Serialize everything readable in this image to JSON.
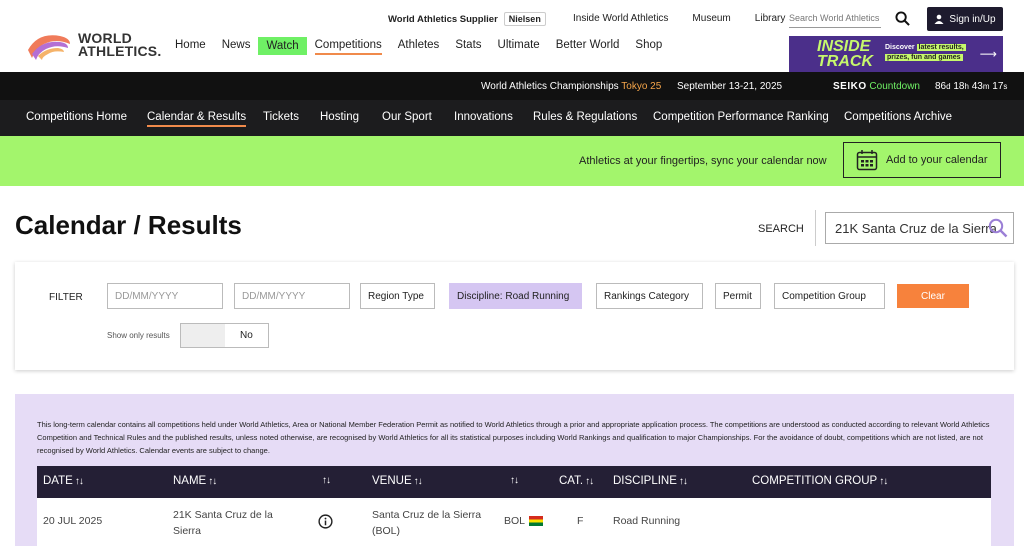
{
  "header": {
    "logo_line1": "WORLD",
    "logo_line2": "ATHLETICS.",
    "supplier_label": "World Athletics Supplier",
    "supplier_name": "Nielsen",
    "top_links": [
      "Inside World Athletics",
      "Museum",
      "Library"
    ],
    "search_placeholder": "Search World Athletics",
    "signin_label": "Sign in/Up",
    "nav": [
      "Home",
      "News",
      "Watch",
      "Competitions",
      "Athletes",
      "Stats",
      "Ultimate",
      "Better World",
      "Shop"
    ],
    "banner_title_1": "INSIDE",
    "banner_title_2": "TRACK",
    "banner_sub_1": "Discover",
    "banner_sub_2": "latest results,",
    "banner_sub_3": "prizes, fun and games"
  },
  "champbar": {
    "event": "World Athletics Championships",
    "event_accent": "Tokyo 25",
    "dates": "September 13-21, 2025",
    "sponsor": "SEIKO",
    "countdown_label": "Countdown",
    "days": "86",
    "days_unit": "d",
    "hours": "18",
    "hours_unit": "h",
    "minutes": "43",
    "minutes_unit": "m",
    "seconds": "17",
    "seconds_unit": "s"
  },
  "compnav": [
    "Competitions Home",
    "Calendar & Results",
    "Tickets",
    "Hosting",
    "Our Sport",
    "Innovations",
    "Rules & Regulations",
    "Competition Performance Ranking",
    "Competitions Archive"
  ],
  "sync": {
    "message": "Athletics at your fingertips, sync your calendar now",
    "button": "Add to your calendar"
  },
  "page": {
    "title": "Calendar / Results",
    "search_label": "SEARCH",
    "search_value": "21K Santa Cruz de la Sierra"
  },
  "filter": {
    "label": "FILTER",
    "date_from_placeholder": "DD/MM/YYYY",
    "date_to_placeholder": "DD/MM/YYYY",
    "region": "Region Type",
    "discipline": "Discipline: Road Running",
    "rankings": "Rankings Category",
    "permit": "Permit",
    "group": "Competition Group",
    "clear": "Clear",
    "show_only_label": "Show only results",
    "show_only_value": "No"
  },
  "disclaimer": "This long-term calendar contains all competitions held under World Athletics, Area or National Member Federation Permit as notified to World Athletics through a prior and appropriate application process. The competitions are understood as conducted according to relevant World Athletics Competition and Technical Rules and the published results, unless noted otherwise, are recognised by World Athletics for all its statistical purposes including World Rankings and qualification to major Championships. For the avoidance of doubt, competitions which are not listed, are not recognised by World Athletics. Calendar events are subject to change.",
  "table": {
    "headers": [
      "DATE",
      "NAME",
      "VENUE",
      "CAT.",
      "DISCIPLINE",
      "COMPETITION GROUP"
    ],
    "rows": [
      {
        "date": "20 JUL 2025",
        "name_1": "21K Santa Cruz de la",
        "name_2": "Sierra",
        "venue_1": "Santa Cruz de la Sierra",
        "venue_2": "(BOL)",
        "country": "BOL",
        "cat": "F",
        "discipline": "Road Running",
        "group": ""
      }
    ]
  },
  "colors": {
    "accent_green": "#a3f56c",
    "watch_green": "#6ff065",
    "accent_orange": "#f7823c",
    "dark": "#1c1c1e",
    "lavender": "#e6dcf6"
  }
}
